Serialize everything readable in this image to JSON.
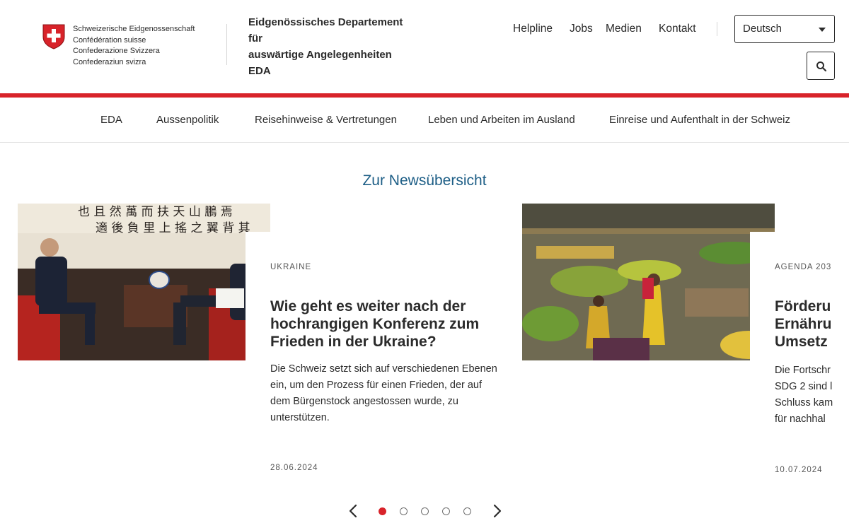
{
  "header": {
    "confederation": [
      "Schweizerische Eidgenossenschaft",
      "Confédération suisse",
      "Confederazione Svizzera",
      "Confederaziun svizra"
    ],
    "department": [
      "Eidgenössisches Departement",
      "für",
      "auswärtige Angelegenheiten",
      "EDA"
    ],
    "top_links": [
      "Helpline",
      "Jobs",
      "Medien",
      "Kontakt"
    ],
    "language": "Deutsch",
    "search_icon": "search-icon"
  },
  "main_nav": [
    "EDA",
    "Aussenpolitik",
    "Reisehinweise & Vertretungen",
    "Leben und Arbeiten im Ausland",
    "Einreise und Aufenthalt in der Schweiz"
  ],
  "news": {
    "overview_link": "Zur Newsübersicht",
    "cards": [
      {
        "kicker": "UKRAINE",
        "title": "Wie geht es weiter nach der hochrangigen Konferenz zum Frieden in der Ukraine?",
        "text": "Die Schweiz setzt sich auf verschiedenen Ebenen ein, um den Prozess für einen Frieden, der auf dem Bürgenstock angestossen wurde, zu unterstützen.",
        "date": "28.06.2024"
      },
      {
        "kicker": "AGENDA 203",
        "title_lines": [
          "Förderu",
          "Ernähru",
          "Umsetz"
        ],
        "text_lines": [
          "Die Fortschr",
          "SDG 2 sind l",
          "Schluss kam",
          "für nachhal"
        ],
        "date": "10.07.2024"
      }
    ]
  },
  "carousel": {
    "dots": 5,
    "active": 0
  },
  "colors": {
    "red": "#d8232a",
    "link_blue": "#1d5e86"
  }
}
